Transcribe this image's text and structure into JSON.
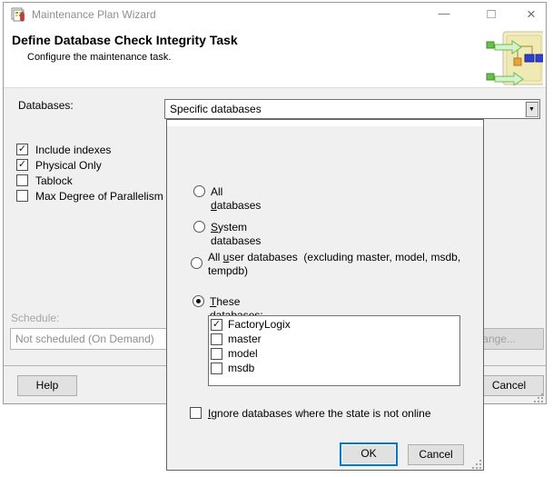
{
  "window": {
    "title": "Maintenance Plan Wizard",
    "controls": {
      "minimize": "—",
      "maximize": "□",
      "close": "×"
    }
  },
  "header": {
    "title": "Define Database Check Integrity Task",
    "subtitle": "Configure the maintenance task."
  },
  "task": {
    "databases_label": "Databases:",
    "databases_value": "Specific databases",
    "options": [
      {
        "label": "Include indexes",
        "checked": true,
        "glyph": "✓"
      },
      {
        "label": "Physical Only",
        "checked": true,
        "glyph": "✓"
      },
      {
        "label": "Tablock",
        "checked": false,
        "glyph": ""
      },
      {
        "label": "Max Degree of Parallelism",
        "checked": false,
        "glyph": ""
      }
    ],
    "schedule": {
      "label": "Schedule:",
      "value": "Not scheduled (On Demand)",
      "change_button": "Change...",
      "enabled": false
    },
    "help_button": "Help",
    "cancel_button": "Cancel"
  },
  "popup": {
    "radios": [
      {
        "pre": "All ",
        "key": "d",
        "post": "atabases",
        "selected": false
      },
      {
        "pre": "",
        "key": "S",
        "post": "ystem databases",
        "selected": false
      },
      {
        "pre": "All ",
        "key": "u",
        "post": "ser databases  (excluding master, model, msdb, tempdb)",
        "selected": false
      },
      {
        "pre": "",
        "key": "T",
        "post": "hese databases:",
        "selected": true
      }
    ],
    "databases": [
      {
        "name": "FactoryLogix",
        "checked": true,
        "glyph": "✓"
      },
      {
        "name": "master",
        "checked": false,
        "glyph": ""
      },
      {
        "name": "model",
        "checked": false,
        "glyph": ""
      },
      {
        "name": "msdb",
        "checked": false,
        "glyph": ""
      }
    ],
    "ignore_offline": {
      "pre": "",
      "key": "I",
      "post": "gnore databases where the state is not online",
      "checked": false
    },
    "ok_button": "OK",
    "cancel_button": "Cancel"
  },
  "icons": {
    "dropdown_arrow": "▼",
    "check": "✓"
  },
  "colors": {
    "accent_focus": "#0078d7",
    "window_bg": "#f0f0f0",
    "titlebar_bg": "#ffffff",
    "popup_border": "#646464"
  }
}
